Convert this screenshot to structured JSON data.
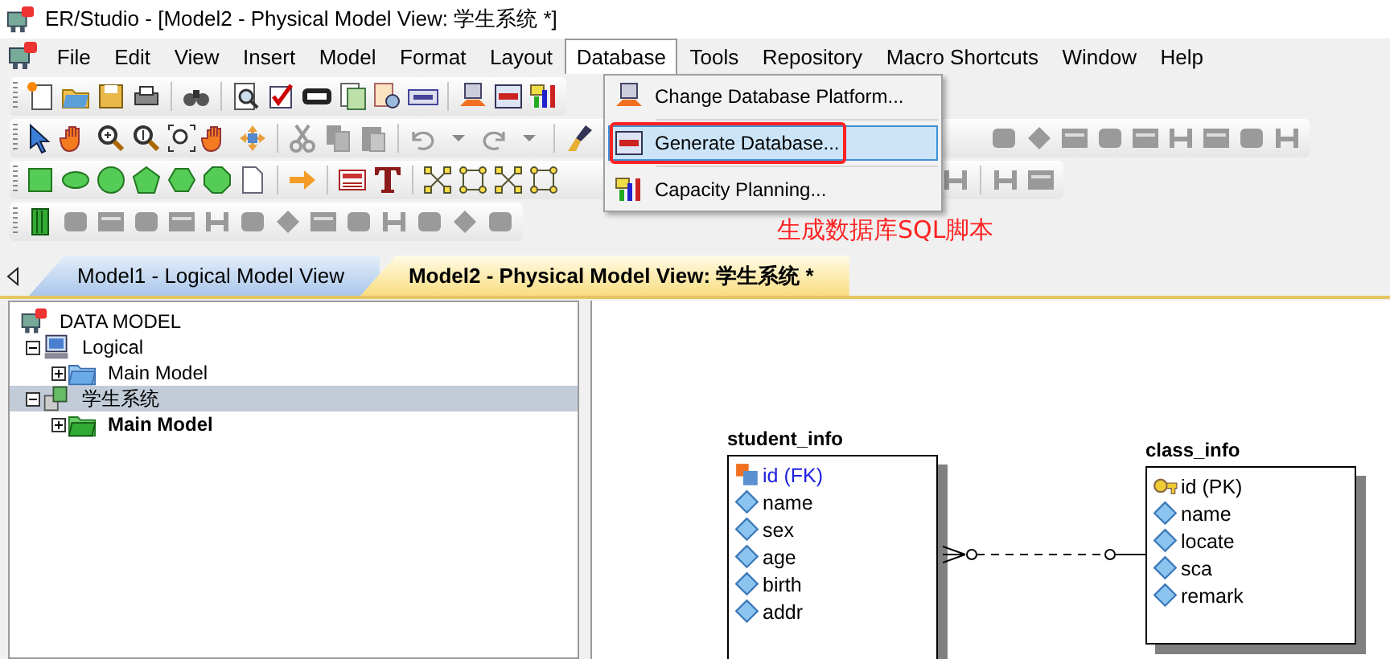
{
  "window": {
    "title": "ER/Studio - [Model2 - Physical Model View: 学生系统 *]"
  },
  "menu": [
    {
      "label": "File",
      "selected": false
    },
    {
      "label": "Edit",
      "selected": false
    },
    {
      "label": "View",
      "selected": false
    },
    {
      "label": "Insert",
      "selected": false
    },
    {
      "label": "Model",
      "selected": false
    },
    {
      "label": "Format",
      "selected": false
    },
    {
      "label": "Layout",
      "selected": false
    },
    {
      "label": "Database",
      "selected": true
    },
    {
      "label": "Tools",
      "selected": false
    },
    {
      "label": "Repository",
      "selected": false
    },
    {
      "label": "Macro Shortcuts",
      "selected": false
    },
    {
      "label": "Window",
      "selected": false
    },
    {
      "label": "Help",
      "selected": false
    }
  ],
  "dropdown": {
    "items": [
      {
        "label": "Change Database Platform...",
        "selected": false
      },
      {
        "label": "Generate Database...",
        "selected": true
      },
      {
        "label": "Capacity Planning...",
        "selected": false
      }
    ]
  },
  "annotation": {
    "text": "生成数据库SQL脚本"
  },
  "tabs": [
    {
      "label": "Model1 - Logical Model View",
      "selected": false
    },
    {
      "label": "Model2 - Physical Model View: 学生系统 *",
      "selected": true
    }
  ],
  "tree": [
    {
      "label": "DATA MODEL",
      "kind": "root",
      "selected": false,
      "children": [
        {
          "label": "Logical",
          "kind": "logical",
          "expanded": true,
          "selected": false,
          "children": [
            {
              "label": "Main Model",
              "kind": "logical-folder",
              "expanded": false,
              "selected": false,
              "active": false
            }
          ]
        },
        {
          "label": "学生系统",
          "kind": "physical",
          "expanded": true,
          "selected": true,
          "children": [
            {
              "label": "Main Model",
              "kind": "physical-folder",
              "expanded": false,
              "selected": false,
              "active": true
            }
          ]
        }
      ]
    }
  ],
  "diagram": {
    "entities": [
      {
        "name": "student_info",
        "attributes": [
          {
            "name": "id (FK)",
            "kind": "foreign-key"
          },
          {
            "name": "name",
            "kind": "attribute"
          },
          {
            "name": "sex",
            "kind": "attribute"
          },
          {
            "name": "age",
            "kind": "attribute"
          },
          {
            "name": "birth",
            "kind": "attribute"
          },
          {
            "name": "addr",
            "kind": "attribute"
          }
        ]
      },
      {
        "name": "class_info",
        "attributes": [
          {
            "name": "id (PK)",
            "kind": "primary-key"
          },
          {
            "name": "name",
            "kind": "attribute"
          },
          {
            "name": "locate",
            "kind": "attribute"
          },
          {
            "name": "sca",
            "kind": "attribute"
          },
          {
            "name": "remark",
            "kind": "attribute"
          }
        ]
      }
    ],
    "relationships": [
      {
        "kind": "non-identifying"
      }
    ]
  }
}
